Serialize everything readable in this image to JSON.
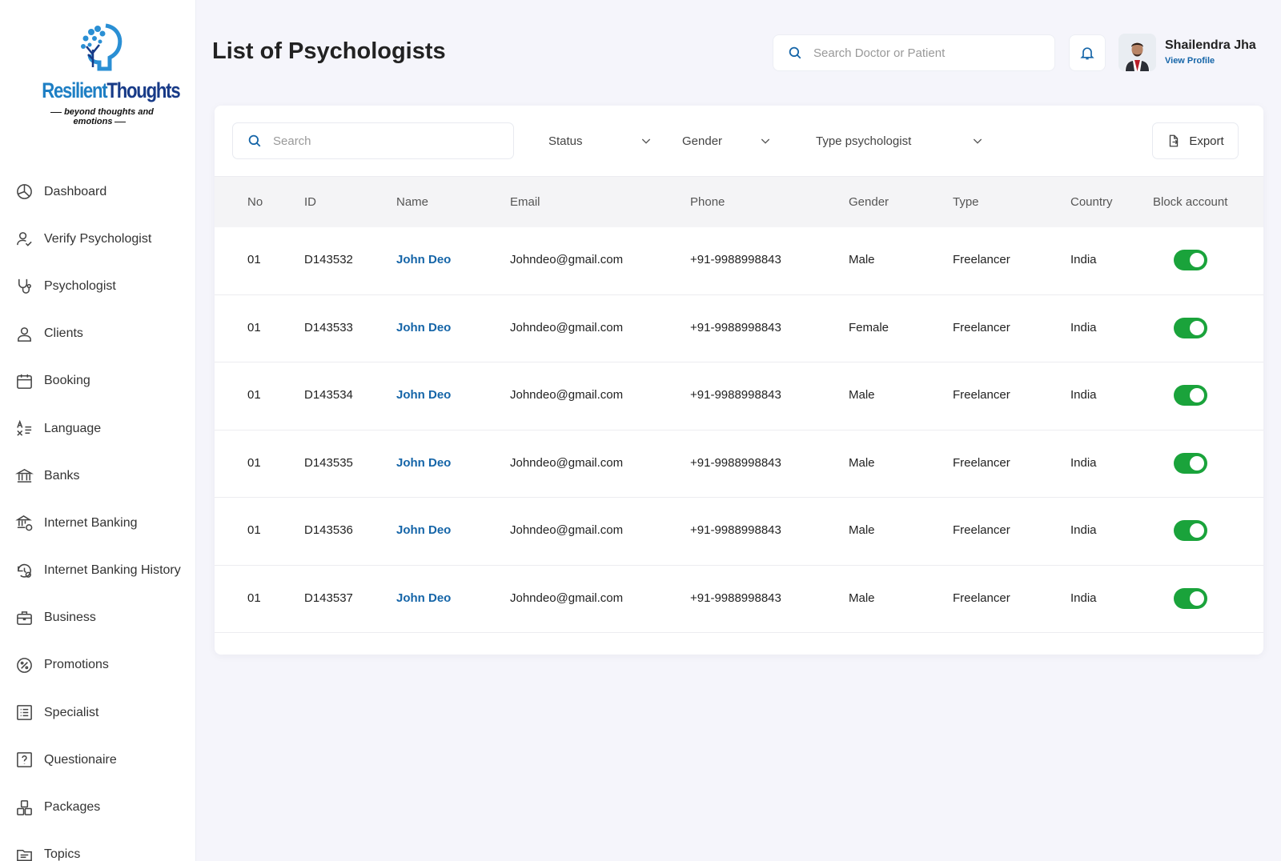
{
  "brand": {
    "name_part1": "Resilient",
    "name_part2": "Thoughts",
    "tagline": "beyond thoughts and emotions",
    "colors": {
      "primary": "#1e7fc4",
      "dark": "#173a87"
    }
  },
  "sidebar": {
    "items": [
      {
        "label": "Dashboard",
        "icon": "pie-chart-icon"
      },
      {
        "label": "Verify Psychologist",
        "icon": "user-check-icon"
      },
      {
        "label": "Psychologist",
        "icon": "stethoscope-icon"
      },
      {
        "label": "Clients",
        "icon": "user-icon"
      },
      {
        "label": "Booking",
        "icon": "calendar-icon"
      },
      {
        "label": "Language",
        "icon": "translate-icon"
      },
      {
        "label": "Banks",
        "icon": "bank-icon"
      },
      {
        "label": "Internet Banking",
        "icon": "bank-network-icon"
      },
      {
        "label": "Internet Banking History",
        "icon": "history-settings-icon"
      },
      {
        "label": "Business",
        "icon": "briefcase-icon"
      },
      {
        "label": "Promotions",
        "icon": "percent-badge-icon"
      },
      {
        "label": "Specialist",
        "icon": "list-icon"
      },
      {
        "label": "Questionaire",
        "icon": "question-square-icon"
      },
      {
        "label": "Packages",
        "icon": "boxes-icon"
      },
      {
        "label": "Topics",
        "icon": "folder-list-icon"
      }
    ]
  },
  "header": {
    "title": "List of Psychologists",
    "search_placeholder": "Search Doctor or Patient",
    "user_name": "Shailendra Jha",
    "view_profile": "View Profile"
  },
  "filters": {
    "search_placeholder": "Search",
    "status": "Status",
    "gender": "Gender",
    "type": "Type psychologist",
    "export": "Export"
  },
  "table": {
    "columns": [
      "No",
      "ID",
      "Name",
      "Email",
      "Phone",
      "Gender",
      "Type",
      "Country",
      "Block account"
    ],
    "rows": [
      {
        "no": "01",
        "id": "D143532",
        "name": "John Deo",
        "email": "Johndeo@gmail.com",
        "phone": "+91-9988998843",
        "gender": "Male",
        "type": "Freelancer",
        "country": "India",
        "blocked": true
      },
      {
        "no": "01",
        "id": "D143533",
        "name": "John Deo",
        "email": "Johndeo@gmail.com",
        "phone": "+91-9988998843",
        "gender": "Female",
        "type": "Freelancer",
        "country": "India",
        "blocked": true
      },
      {
        "no": "01",
        "id": "D143534",
        "name": "John Deo",
        "email": "Johndeo@gmail.com",
        "phone": "+91-9988998843",
        "gender": "Male",
        "type": "Freelancer",
        "country": "India",
        "blocked": true
      },
      {
        "no": "01",
        "id": "D143535",
        "name": "John Deo",
        "email": "Johndeo@gmail.com",
        "phone": "+91-9988998843",
        "gender": "Male",
        "type": "Freelancer",
        "country": "India",
        "blocked": true
      },
      {
        "no": "01",
        "id": "D143536",
        "name": "John Deo",
        "email": "Johndeo@gmail.com",
        "phone": "+91-9988998843",
        "gender": "Male",
        "type": "Freelancer",
        "country": "India",
        "blocked": true
      },
      {
        "no": "01",
        "id": "D143537",
        "name": "John Deo",
        "email": "Johndeo@gmail.com",
        "phone": "+91-9988998843",
        "gender": "Male",
        "type": "Freelancer",
        "country": "India",
        "blocked": true
      }
    ]
  },
  "colors": {
    "accent": "#1565a8",
    "toggle_on": "#1aa33b",
    "background": "#f5f5fb"
  }
}
